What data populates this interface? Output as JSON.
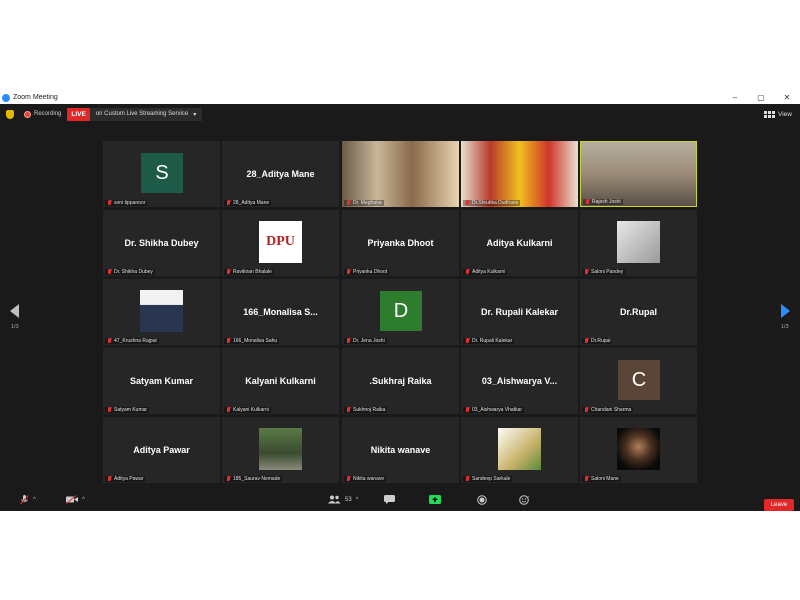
{
  "window": {
    "title": "Zoom Meeting",
    "controls": [
      "–",
      "▢",
      "✕"
    ]
  },
  "status": {
    "recording_label": "Recording",
    "live_label": "LIVE",
    "stream_label": "on Custom Live Streaming Service",
    "view_label": "View"
  },
  "pager": {
    "left": "1/3",
    "right": "1/3"
  },
  "tiles": [
    {
      "label": "soni tippanoor",
      "kind": "avatar",
      "avatar_letter": "S",
      "avatar_color": "#1d5a48"
    },
    {
      "label": "28_Aditya Mane",
      "kind": "name",
      "display": "28_Aditya Mane"
    },
    {
      "label": "Dr. Meghana",
      "kind": "video"
    },
    {
      "label": "Dr.Shrutika Dudhane",
      "kind": "video"
    },
    {
      "label": "Rajesh Joshi",
      "kind": "video"
    },
    {
      "label": "Dr. Shikha Dubey",
      "kind": "name",
      "display": "Dr. Shikha Dubey"
    },
    {
      "label": "Ravikiran Bhalale",
      "kind": "logo",
      "logo_text": "DPU"
    },
    {
      "label": "Priyanka Dhoot",
      "kind": "name",
      "display": "Priyanka Dhoot"
    },
    {
      "label": "Aditya Kulkarni",
      "kind": "name",
      "display": "Aditya Kulkarni"
    },
    {
      "label": "Saloni Pandey",
      "kind": "photo"
    },
    {
      "label": "47_Krushna Rajput",
      "kind": "photo"
    },
    {
      "label": "166_Monalisa Sahu",
      "kind": "name",
      "display": "166_Monalisa S..."
    },
    {
      "label": "Dr. Jena Joshi",
      "kind": "avatar",
      "avatar_letter": "D",
      "avatar_color": "#2e7d2e"
    },
    {
      "label": "Dr. Rupali Kalekar",
      "kind": "name",
      "display": "Dr. Rupali Kalekar"
    },
    {
      "label": "Dr.Rupal",
      "kind": "name",
      "display": "Dr.Rupal"
    },
    {
      "label": "Satyam Kumar",
      "kind": "name",
      "display": "Satyam Kumar"
    },
    {
      "label": "Kalyani Kulkarni",
      "kind": "name",
      "display": "Kalyani Kulkarni"
    },
    {
      "label": "Sukhnoj Raika",
      "kind": "name",
      "display": ".Sukhraj Raika"
    },
    {
      "label": "03_Aishwarya Vhatkar",
      "kind": "name",
      "display": "03_Aishwarya V..."
    },
    {
      "label": "Chandani Sharma",
      "kind": "avatar",
      "avatar_letter": "C",
      "avatar_color": "#5b4438"
    },
    {
      "label": "Aditya Pawar",
      "kind": "name",
      "display": "Aditya Pawar"
    },
    {
      "label": "185_Saurav Nemade",
      "kind": "photo"
    },
    {
      "label": "Nikita wanave",
      "kind": "name",
      "display": "Nikita wanave"
    },
    {
      "label": "Sandeep Sarkale",
      "kind": "photo"
    },
    {
      "label": "Saloni Mane",
      "kind": "photo"
    }
  ],
  "toolbar": {
    "participants_count": "53",
    "leave_label": "Leave"
  }
}
